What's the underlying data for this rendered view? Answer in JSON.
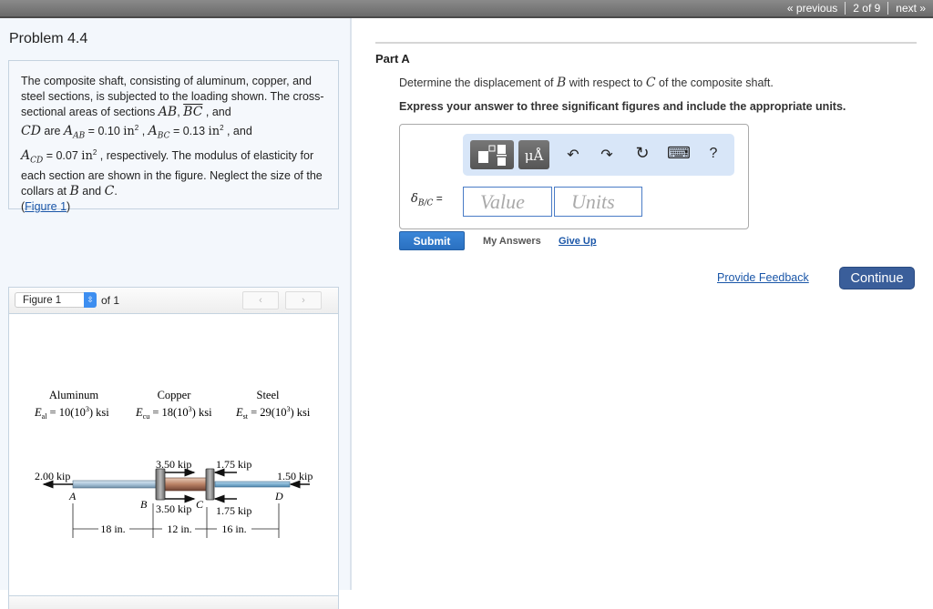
{
  "topnav": {
    "previous": "« previous",
    "position": "2 of 9",
    "next": "next »"
  },
  "problem": {
    "title": "Problem 4.4",
    "text": {
      "p1": "The composite shaft, consisting of aluminum, copper, and steel sections, is subjected to the loading shown. The cross-sectional areas of sections ",
      "AB": "AB",
      "comma1": ", ",
      "BC": "BC",
      "and1": "  , and",
      "CD": "CD",
      "are": " are ",
      "A": "A",
      "sub_AB": "AB",
      "val_AB": " = 0.10 ",
      "unit": "in",
      "sq": "2",
      "sep": " , ",
      "sub_BC": "BC",
      "val_BC": " = 0.13 ",
      "and2": " , and",
      "sub_CD": "CD",
      "val_CD": " = 0.07 ",
      "p2": " , respectively. The modulus of elasticity for each section are shown in the figure. Neglect the size of the collars at ",
      "B": "B",
      "and3": " and ",
      "C": "C",
      "period": ".",
      "fig_open": "(",
      "fig_link": "Figure 1",
      "fig_close": ")"
    }
  },
  "figure_panel": {
    "select_value": "Figure 1",
    "of_label": "of 1",
    "prev_icon": "‹",
    "next_icon": "›",
    "figure": {
      "materials": [
        {
          "name": "Aluminum",
          "E_sym": "E",
          "E_sub": "al",
          "E_val": " = 10(10",
          "E_exp": "3",
          "E_unit": ") ksi"
        },
        {
          "name": "Copper",
          "E_sym": "E",
          "E_sub": "cu",
          "E_val": " = 18(10",
          "E_exp": "3",
          "E_unit": ") ksi"
        },
        {
          "name": "Steel",
          "E_sym": "E",
          "E_sub": "st",
          "E_val": " = 29(10",
          "E_exp": "3",
          "E_unit": ") ksi"
        }
      ],
      "loads": {
        "A": "2.00 kip",
        "B_top": "3.50 kip",
        "B_bottom": "3.50 kip",
        "C_top": "1.75 kip",
        "C_bottom": "1.75 kip",
        "D": "1.50 kip"
      },
      "points": {
        "A": "A",
        "B": "B",
        "C": "C",
        "D": "D"
      },
      "dims": {
        "AB": "18 in.",
        "BC": "12 in.",
        "CD": "16 in."
      }
    }
  },
  "part": {
    "title": "Part A",
    "question_pre": "Determine the displacement of ",
    "B": "B",
    "question_mid": " with respect to ",
    "C": "C",
    "question_post": " of the composite shaft.",
    "instruction": "Express your answer to three significant figures and include the appropriate units.",
    "toolbar": {
      "templates": "templates-icon",
      "units": "μÅ",
      "undo": "↶",
      "redo": "↷",
      "reset": "↻",
      "keyboard": "⌨",
      "help": "?"
    },
    "answer_label": {
      "sym": "δ",
      "sub": "B/C",
      "eq": " ="
    },
    "value_placeholder": "Value",
    "units_placeholder": "Units",
    "submit": "Submit",
    "my_answers": "My Answers",
    "give_up": "Give Up"
  },
  "footer": {
    "feedback": "Provide Feedback",
    "continue": "Continue"
  }
}
